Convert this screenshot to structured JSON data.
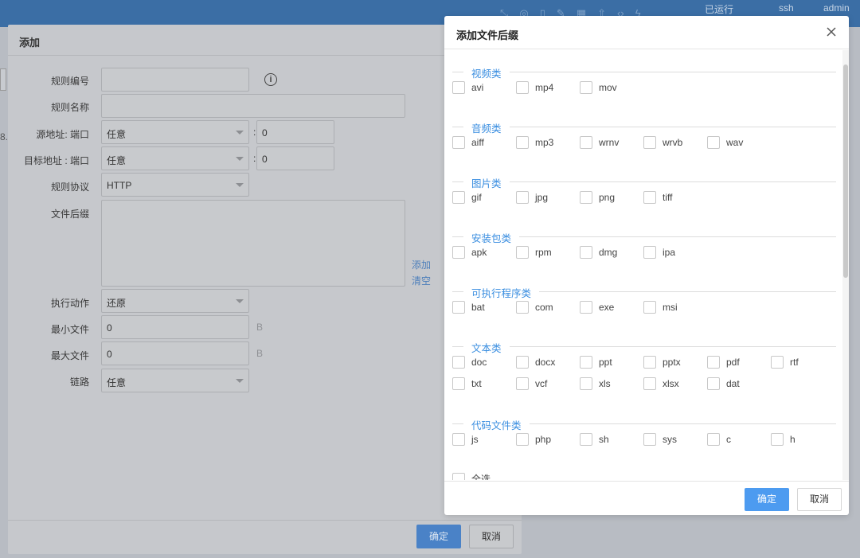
{
  "topbar": {
    "status": "已运行",
    "service": "ssh",
    "user": "admin"
  },
  "bg_edge_text": "8.",
  "main_dialog": {
    "title": "添加",
    "fields": {
      "rule_no_label": "规则编号",
      "rule_name_label": "规则名称",
      "src_label": "源地址: 端口",
      "src_value": "任意",
      "src_port": "0",
      "dst_label": "目标地址 : 端口",
      "dst_value": "任意",
      "dst_port": "0",
      "protocol_label": "规则协议",
      "protocol_value": "HTTP",
      "suffix_label": "文件后缀",
      "add_link": "添加",
      "clear_link": "清空",
      "action_label": "执行动作",
      "action_value": "还原",
      "min_label": "最小文件",
      "min_value": "0",
      "min_unit": "B",
      "max_label": "最大文件",
      "max_value": "0",
      "max_unit": "B",
      "link_label": "链路",
      "link_value": "任意",
      "colon": ":"
    },
    "confirm": "确定",
    "cancel": "取消"
  },
  "suffix_dialog": {
    "title": "添加文件后缀",
    "categories": [
      {
        "name": "视频类",
        "items": [
          "avi",
          "mp4",
          "mov"
        ]
      },
      {
        "name": "音频类",
        "items": [
          "aiff",
          "mp3",
          "wrnv",
          "wrvb",
          "wav"
        ]
      },
      {
        "name": "图片类",
        "items": [
          "gif",
          "jpg",
          "png",
          "tiff"
        ]
      },
      {
        "name": "安装包类",
        "items": [
          "apk",
          "rpm",
          "dmg",
          "ipa"
        ]
      },
      {
        "name": "可执行程序类",
        "items": [
          "bat",
          "com",
          "exe",
          "msi"
        ]
      },
      {
        "name": "文本类",
        "items": [
          "doc",
          "docx",
          "ppt",
          "pptx",
          "pdf",
          "rtf",
          "txt",
          "vcf",
          "xls",
          "xlsx",
          "dat"
        ]
      },
      {
        "name": "代码文件类",
        "items": [
          "js",
          "php",
          "sh",
          "sys",
          "c",
          "h"
        ]
      }
    ],
    "select_all": "全选",
    "confirm": "确定",
    "cancel": "取消"
  },
  "colors": {
    "accent": "#4d9bf0",
    "category": "#3a8ee0",
    "topbar": "#3b6ea5"
  }
}
